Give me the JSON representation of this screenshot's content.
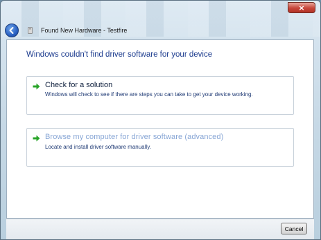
{
  "window": {
    "title": "Found New Hardware - Testfire",
    "close_glyph": "×"
  },
  "content": {
    "heading": "Windows couldn't find driver software for your device",
    "options": [
      {
        "title": "Check for a solution",
        "description": "Windows will check to see if there are steps you can take to get your device working.",
        "icon": "green-arrow-icon"
      },
      {
        "title": "Browse my computer for driver software (advanced)",
        "description": "Locate and install driver software manually.",
        "icon": "green-arrow-icon"
      }
    ]
  },
  "footer": {
    "cancel_label": "Cancel"
  },
  "colors": {
    "heading": "#1e3d8f",
    "accent_arrow": "#2aa52a",
    "close_button": "#c7463a"
  }
}
